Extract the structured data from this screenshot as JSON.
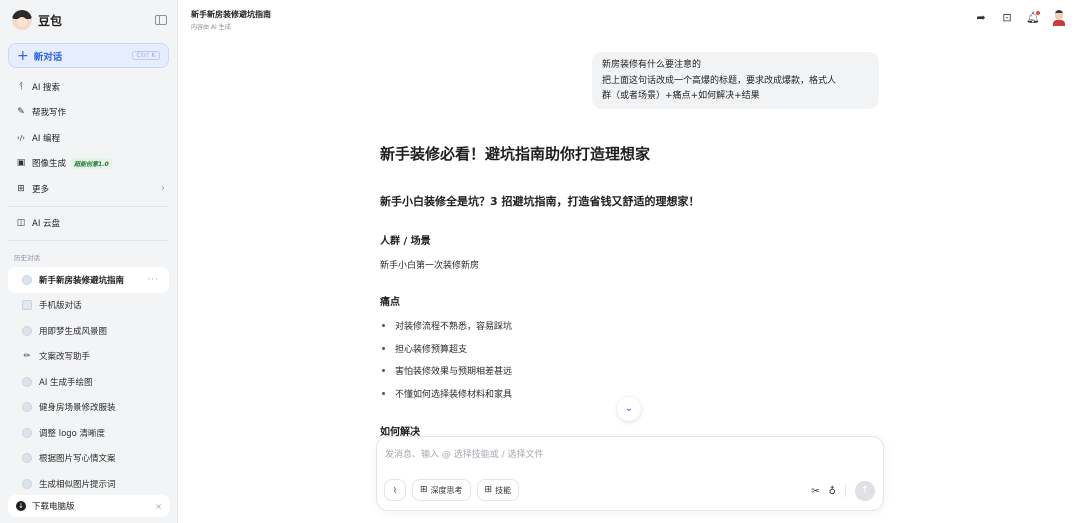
{
  "sidebar": {
    "brand": "豆包",
    "new_chat": {
      "label": "新对话",
      "shortcut": "Ctrl K"
    },
    "nav": [
      {
        "icon": "search-icon",
        "glyph": "ᛩ",
        "label": "AI 搜索"
      },
      {
        "icon": "pen-icon",
        "glyph": "✎",
        "label": "帮我写作"
      },
      {
        "icon": "code-icon",
        "glyph": "‹/›",
        "label": "AI 编程"
      },
      {
        "icon": "image-icon",
        "glyph": "▣",
        "label": "图像生成",
        "tag": "超能创意1.0"
      },
      {
        "icon": "grid-icon",
        "glyph": "⊞",
        "label": "更多"
      }
    ],
    "cloud": {
      "icon": "cloud-drive-icon",
      "glyph": "◫",
      "label": "AI 云盘"
    },
    "history_title": "历史对话",
    "history": [
      {
        "label": "新手新房装修避坑指南",
        "active": true
      },
      {
        "label": "手机版对话"
      },
      {
        "label": "用即梦生成风景图"
      },
      {
        "label": "文案改写助手"
      },
      {
        "label": "AI 生成手绘图"
      },
      {
        "label": "健身房场景修改服装"
      },
      {
        "label": "调整 logo 清晰度"
      },
      {
        "label": "根据图片写心情文案"
      },
      {
        "label": "生成相似图片提示词"
      }
    ],
    "download": {
      "label": "下载电脑版"
    }
  },
  "topbar": {
    "title": "新手新房装修避坑指南",
    "subtitle": "内容由 AI 生成"
  },
  "user_message": {
    "lines": [
      "新房装修有什么要注意的",
      "把上面这句话改成一个高爆的标题，要求改成爆款，格式人",
      "群（或者场景）+痛点+如何解决+结果"
    ]
  },
  "answer": {
    "h1": "新手装修必看！避坑指南助你打造理想家",
    "h2": "新手小白装修全是坑？3 招避坑指南，打造省钱又舒适的理想家！",
    "section_audience": {
      "title": "人群 / 场景",
      "text": "新手小白第一次装修新房"
    },
    "section_pain": {
      "title": "痛点",
      "items": [
        "对装修流程不熟悉，容易踩坑",
        "担心装修预算超支",
        "害怕装修效果与预期相差甚远",
        "不懂如何选择装修材料和家具"
      ]
    },
    "section_solution": {
      "title": "如何解决"
    }
  },
  "composer": {
    "placeholder": "发消息、输入 @ 选择技能或 / 选择文件",
    "deep_think": "深度思考",
    "skills": "技能"
  }
}
